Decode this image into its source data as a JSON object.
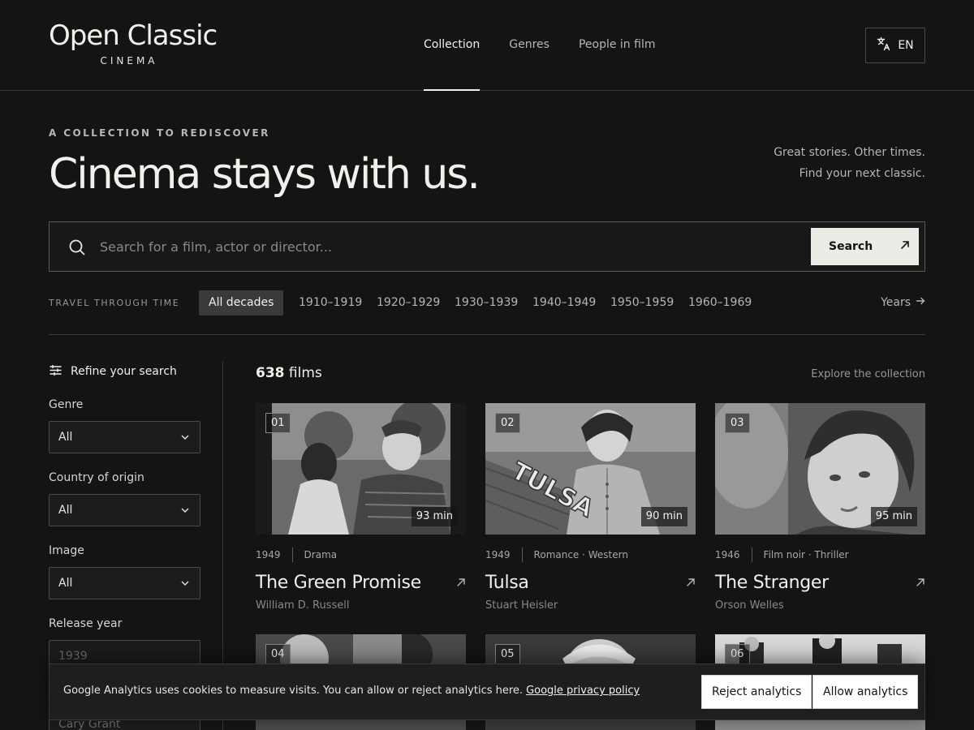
{
  "brand": {
    "title": "Open Classic",
    "subtitle": "CINEMA"
  },
  "nav": {
    "items": [
      "Collection",
      "Genres",
      "People in film"
    ]
  },
  "lang": {
    "label": "EN",
    "icon": "translate-icon"
  },
  "hero": {
    "eyebrow": "A COLLECTION TO REDISCOVER",
    "title": "Cinema stays with us.",
    "side_line1": "Great stories. Other times.",
    "side_line2": "Find your next classic."
  },
  "search": {
    "placeholder": "Search for a film, actor or director...",
    "button": "Search"
  },
  "decades": {
    "label": "TRAVEL THROUGH TIME",
    "items": [
      "All decades",
      "1910–1919",
      "1920–1929",
      "1930–1939",
      "1940–1949",
      "1950–1959",
      "1960–1969"
    ],
    "selected": "All decades",
    "more": "Years"
  },
  "sidebar": {
    "refine": "Refine your search",
    "genre_label": "Genre",
    "genre_value": "All",
    "country_label": "Country of origin",
    "country_value": "All",
    "image_label": "Image",
    "image_value": "All",
    "year_label": "Release year",
    "year_placeholder": "1939",
    "cast_placeholder": "Cary Grant"
  },
  "results": {
    "count": "638",
    "unit": "films",
    "explore": "Explore the collection",
    "films": [
      {
        "num": "01",
        "duration": "93 min",
        "year": "1949",
        "genre": "Drama",
        "title": "The Green Promise",
        "director": "William D. Russell"
      },
      {
        "num": "02",
        "duration": "90 min",
        "year": "1949",
        "genre": "Romance · Western",
        "title": "Tulsa",
        "director": "Stuart Heisler"
      },
      {
        "num": "03",
        "duration": "95 min",
        "year": "1946",
        "genre": "Film noir · Thriller",
        "title": "The Stranger",
        "director": "Orson Welles"
      },
      {
        "num": "04"
      },
      {
        "num": "05"
      },
      {
        "num": "06"
      }
    ]
  },
  "cookie": {
    "text": "Google Analytics uses cookies to measure visits. You can allow or reject analytics here.",
    "link": "Google privacy policy",
    "reject": "Reject analytics",
    "allow": "Allow analytics"
  }
}
